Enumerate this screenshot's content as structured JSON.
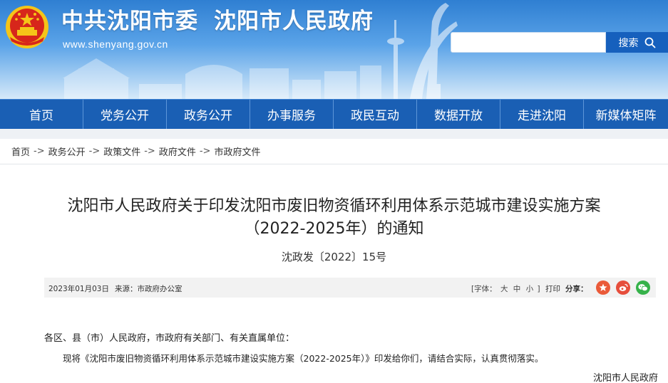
{
  "header": {
    "site_title_1": "中共沈阳市委",
    "site_title_2": "沈阳市人民政府",
    "site_url": "www.shenyang.gov.cn",
    "search_placeholder": "",
    "search_label": "搜索",
    "brand_color": "#1a5fb4",
    "emblem_red": "#d7261b",
    "emblem_gold": "#f5c518"
  },
  "nav": {
    "items": [
      "首页",
      "党务公开",
      "政务公开",
      "办事服务",
      "政民互动",
      "数据开放",
      "走进沈阳",
      "新媒体矩阵"
    ]
  },
  "breadcrumb": {
    "items": [
      "首页",
      "政务公开",
      "政策文件",
      "政府文件",
      "市政府文件"
    ],
    "separator": "->"
  },
  "article": {
    "title_line1": "沈阳市人民政府关于印发沈阳市废旧物资循环利用体系示范城市建设实施方案",
    "title_line2": "（2022-2025年）的通知",
    "doc_number": "沈政发〔2022〕15号",
    "date": "2023年01月03日",
    "source": "来源：市政府办公室",
    "font_label": "[字体：",
    "font_sizes": [
      "大",
      "中",
      "小"
    ],
    "font_close": "]",
    "print_label": "打印",
    "share_label": "分享：",
    "share_icons": [
      "qzone-icon",
      "weibo-icon",
      "wechat-icon"
    ],
    "salutation": "各区、县（市）人民政府，市政府有关部门、有关直属单位：",
    "paragraph": "现将《沈阳市废旧物资循环利用体系示范城市建设实施方案（2022-2025年）》印发给你们，请结合实际，认真贯彻落实。",
    "signature": "沈阳市人民政府"
  }
}
